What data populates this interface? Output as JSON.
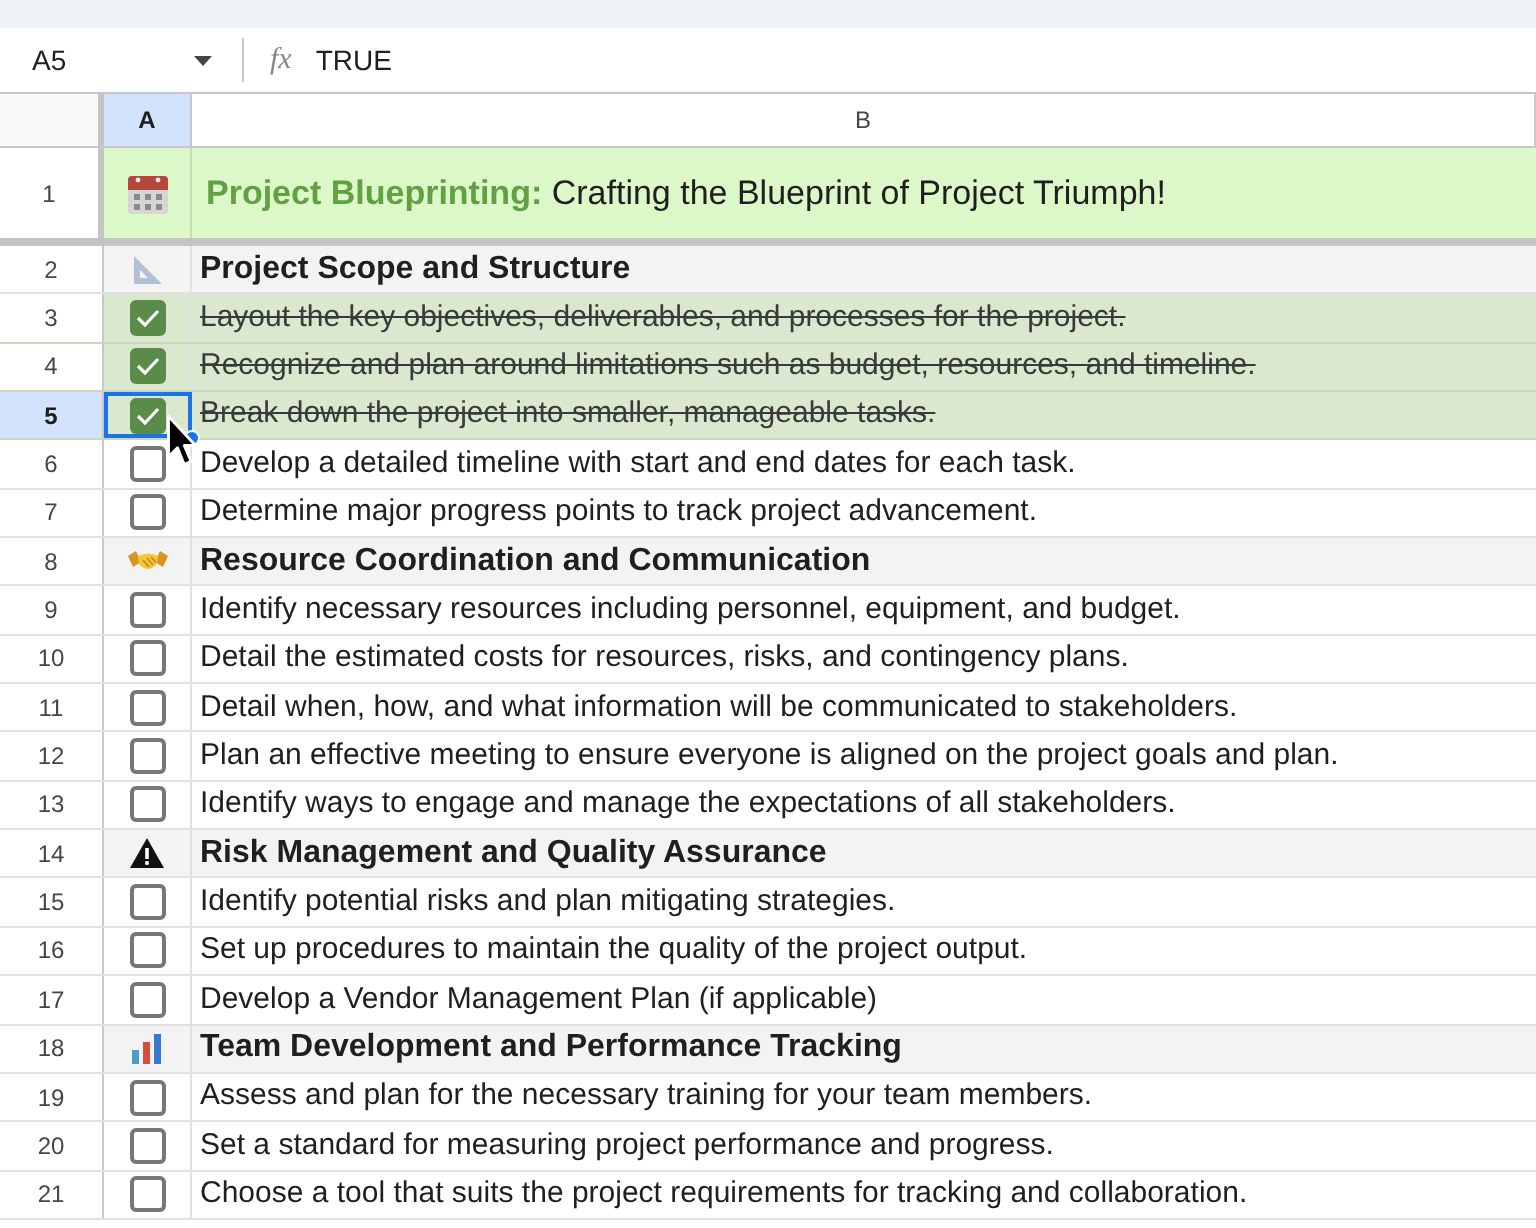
{
  "formula_bar": {
    "cell_ref": "A5",
    "function_symbol": "fx",
    "formula": "TRUE"
  },
  "columns": [
    {
      "label": "A",
      "selected": true
    },
    {
      "label": "B",
      "selected": false
    }
  ],
  "rows": [
    {
      "kind": "title",
      "row_number": "1",
      "highlight": "Project Blueprinting:",
      "text": "Crafting the Blueprint of Project Triumph!",
      "selected": false
    },
    {
      "kind": "section",
      "row_number": "2",
      "text": "Project Scope and Structure",
      "selected": false
    },
    {
      "kind": "task",
      "row_number": "3",
      "text": "Layout the key objectives, deliverables, and processes for the project.",
      "checked": true,
      "selected": false
    },
    {
      "kind": "task",
      "row_number": "4",
      "text": "Recognize and plan around limitations such as budget, resources, and timeline.",
      "checked": true,
      "selected": false
    },
    {
      "kind": "task",
      "row_number": "5",
      "text": "Break down the project into smaller, manageable tasks.",
      "checked": true,
      "selected": true
    },
    {
      "kind": "task",
      "row_number": "6",
      "text": "Develop a detailed timeline with start and end dates for each task.",
      "checked": false,
      "selected": false
    },
    {
      "kind": "task",
      "row_number": "7",
      "text": "Determine major progress points to track project advancement.",
      "checked": false,
      "selected": false
    },
    {
      "kind": "section",
      "row_number": "8",
      "text": "Resource Coordination and Communication",
      "selected": false
    },
    {
      "kind": "task",
      "row_number": "9",
      "text": "Identify necessary resources including personnel, equipment, and budget.",
      "checked": false,
      "selected": false
    },
    {
      "kind": "task",
      "row_number": "10",
      "text": "Detail the estimated costs for resources, risks, and contingency plans.",
      "checked": false,
      "selected": false
    },
    {
      "kind": "task",
      "row_number": "11",
      "text": "Detail when, how, and what information will be communicated to stakeholders.",
      "checked": false,
      "selected": false
    },
    {
      "kind": "task",
      "row_number": "12",
      "text": "Plan an effective meeting to ensure everyone is aligned on the project goals and plan.",
      "checked": false,
      "selected": false
    },
    {
      "kind": "task",
      "row_number": "13",
      "text": "Identify ways to engage and manage the expectations of all stakeholders.",
      "checked": false,
      "selected": false
    },
    {
      "kind": "section",
      "row_number": "14",
      "text": "Risk Management and Quality Assurance",
      "selected": false
    },
    {
      "kind": "task",
      "row_number": "15",
      "text": "Identify potential risks and plan mitigating strategies.",
      "checked": false,
      "selected": false
    },
    {
      "kind": "task",
      "row_number": "16",
      "text": "Set up procedures to maintain the quality of the project output.",
      "checked": false,
      "selected": false
    },
    {
      "kind": "task",
      "row_number": "17",
      "text": "Develop a Vendor Management Plan (if applicable)",
      "checked": false,
      "selected": false
    },
    {
      "kind": "section",
      "row_number": "18",
      "text": "Team Development and Performance Tracking",
      "selected": false
    },
    {
      "kind": "task",
      "row_number": "19",
      "text": "Assess and plan for the necessary training for your team members.",
      "checked": false,
      "selected": false
    },
    {
      "kind": "task",
      "row_number": "20",
      "text": "Set a standard for measuring project performance and progress.",
      "checked": false,
      "selected": false
    },
    {
      "kind": "task",
      "row_number": "21",
      "text": "Choose a tool that suits the project requirements for tracking and collaboration.",
      "checked": false,
      "selected": false
    }
  ]
}
